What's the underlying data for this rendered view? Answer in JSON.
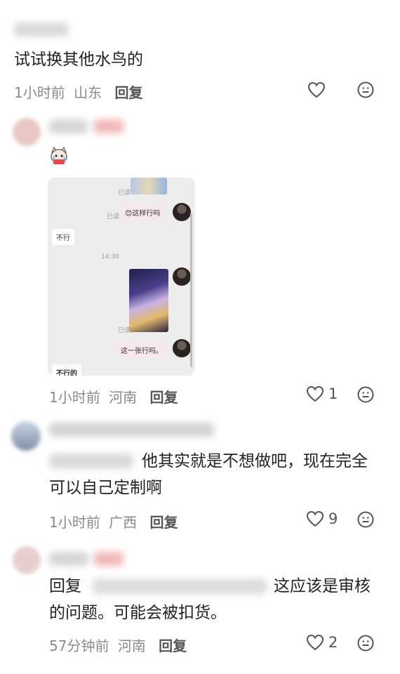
{
  "comments": [
    {
      "text": "试试换其他水鸟的",
      "time": "1小时前",
      "location": "山东",
      "reply_label": "回复",
      "likes": ""
    },
    {
      "text": "",
      "time": "1小时前",
      "location": "河南",
      "reply_label": "回复",
      "likes": "1",
      "screenshot": {
        "read1": "已读",
        "msg1": "😊这样行吗",
        "reply1": "不行",
        "timestamp": "14:30",
        "read2": "已读",
        "read3": "已读",
        "msg2": "这一张行吗。",
        "reply2": "不行的"
      }
    },
    {
      "text": "他其实就是不想做吧，现在完全可以自己定制啊",
      "time": "1小时前",
      "location": "广西",
      "reply_label": "回复",
      "likes": "9"
    },
    {
      "reply_prefix": "回复",
      "text": "这应该是审核的问题。可能会被扣货。",
      "time": "57分钟前",
      "location": "河南",
      "reply_label": "回复",
      "likes": "2"
    }
  ],
  "colors": {
    "text": "#222222",
    "meta": "#8a8a8a",
    "icon": "#555555"
  }
}
